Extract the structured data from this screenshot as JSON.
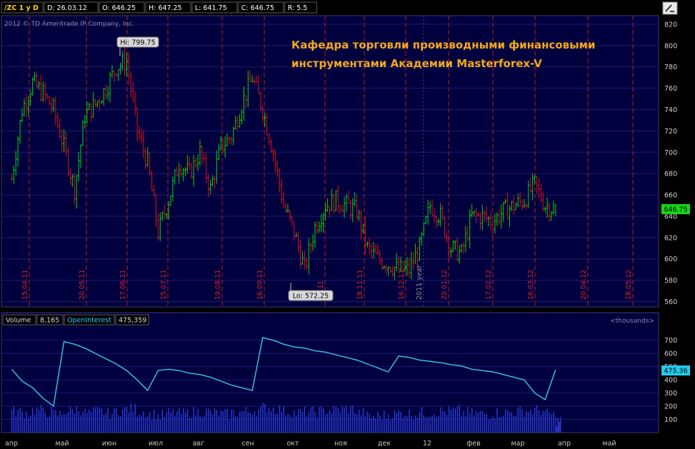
{
  "header": {
    "symbol": "/ZC 1 y D",
    "fields": [
      "D: 26.03.12",
      "O: 646.25",
      "H: 647.25",
      "L: 641.75",
      "C: 646.75",
      "R: 5.5"
    ],
    "copyright": "2012 © TD Ameritrade IP Company, Inc."
  },
  "overlay_title_line1": "Кафедра торговли производными финансовыми",
  "overlay_title_line2": "инструментами Академии Masterforex-V",
  "colors": {
    "background": "#00003e",
    "grid": "#1c1c70",
    "up_bar": "#00d800",
    "down_bar": "#e01010",
    "vline": "#c81818",
    "oi_line": "#33ccee",
    "volume": "#2a3cd8",
    "accent_title": "#f2a81c",
    "last_price_bg": "#16d616",
    "last_oi_bg": "#22ccee"
  },
  "chart_data": [
    {
      "type": "line",
      "title": "",
      "ylim": [
        555,
        828
      ],
      "y_ticks": [
        560,
        580,
        600,
        620,
        640,
        660,
        680,
        700,
        720,
        740,
        760,
        780,
        800,
        820
      ],
      "x_event_labels": [
        "15.04.11",
        "20.05.11",
        "17.06.11",
        "15.07.11",
        "19.08.11",
        "16.09.11",
        "10.11",
        "18.11.11",
        "16.12.11",
        "2011 year",
        "20.01.12",
        "17.02.12",
        "16.03.12",
        "20.04.12",
        "18.05.12"
      ],
      "x_month_labels": [
        "апр",
        "май",
        "июн",
        "июл",
        "авг",
        "сен",
        "окт",
        "ноя",
        "дек",
        "12",
        "фев",
        "мар",
        "апр",
        "май"
      ],
      "annotations": {
        "hi": "Hi: 799.75",
        "lo": "Lo: 572.25"
      },
      "last_price": "646.75",
      "series": [
        {
          "x": [
            "2011-03-28",
            "2011-04-04",
            "2011-04-11",
            "2011-04-18",
            "2011-04-25",
            "2011-05-02",
            "2011-05-09",
            "2011-05-16",
            "2011-05-23",
            "2011-05-30",
            "2011-06-06",
            "2011-06-13",
            "2011-06-20",
            "2011-06-27",
            "2011-07-04",
            "2011-07-11",
            "2011-07-18",
            "2011-07-25",
            "2011-08-01",
            "2011-08-08",
            "2011-08-15",
            "2011-08-22",
            "2011-08-29",
            "2011-09-05",
            "2011-09-12",
            "2011-09-19",
            "2011-09-26",
            "2011-10-03",
            "2011-10-10",
            "2011-10-17",
            "2011-10-24",
            "2011-10-31",
            "2011-11-07",
            "2011-11-14",
            "2011-11-21",
            "2011-11-28",
            "2011-12-05",
            "2011-12-12",
            "2011-12-19",
            "2011-12-26",
            "2012-01-02",
            "2012-01-09",
            "2012-01-16",
            "2012-01-23",
            "2012-01-30",
            "2012-02-06",
            "2012-02-13",
            "2012-02-20",
            "2012-02-27",
            "2012-03-05",
            "2012-03-12",
            "2012-03-19",
            "2012-03-26"
          ],
          "values": [
            675,
            740,
            765,
            755,
            740,
            705,
            665,
            735,
            745,
            760,
            780,
            785,
            720,
            690,
            625,
            655,
            690,
            680,
            700,
            665,
            705,
            715,
            745,
            770,
            740,
            700,
            650,
            625,
            590,
            630,
            650,
            655,
            650,
            645,
            610,
            600,
            595,
            590,
            590,
            610,
            650,
            640,
            610,
            605,
            640,
            640,
            635,
            645,
            650,
            655,
            670,
            650,
            646.75
          ]
        }
      ]
    },
    {
      "type": "line",
      "title": "",
      "header": {
        "volume_label": "Volume",
        "volume_value": "8,165",
        "oi_label": "OpenInterest",
        "oi_value": "475,359",
        "units": "<thousands>"
      },
      "ylim": [
        0,
        790
      ],
      "y_ticks": [
        100,
        200,
        300,
        400,
        500,
        600,
        700
      ],
      "last_value": "475.36",
      "series": [
        {
          "name": "OpenInterest",
          "x": [
            "2011-03-28",
            "2011-04-04",
            "2011-04-11",
            "2011-04-18",
            "2011-04-25",
            "2011-05-02",
            "2011-05-09",
            "2011-05-16",
            "2011-05-23",
            "2011-05-30",
            "2011-06-06",
            "2011-06-13",
            "2011-06-20",
            "2011-06-27",
            "2011-07-04",
            "2011-07-11",
            "2011-07-18",
            "2011-07-25",
            "2011-08-01",
            "2011-08-08",
            "2011-08-15",
            "2011-08-22",
            "2011-08-29",
            "2011-09-05",
            "2011-09-12",
            "2011-09-19",
            "2011-09-26",
            "2011-10-03",
            "2011-10-10",
            "2011-10-17",
            "2011-10-24",
            "2011-10-31",
            "2011-11-07",
            "2011-11-14",
            "2011-11-21",
            "2011-11-28",
            "2011-12-05",
            "2011-12-12",
            "2011-12-19",
            "2011-12-26",
            "2012-01-02",
            "2012-01-09",
            "2012-01-16",
            "2012-01-23",
            "2012-01-30",
            "2012-02-06",
            "2012-02-13",
            "2012-02-20",
            "2012-02-27",
            "2012-03-05",
            "2012-03-12",
            "2012-03-19",
            "2012-03-26"
          ],
          "values": [
            480,
            390,
            340,
            260,
            200,
            690,
            670,
            640,
            600,
            560,
            520,
            470,
            400,
            320,
            470,
            480,
            470,
            450,
            440,
            420,
            390,
            360,
            340,
            320,
            720,
            700,
            670,
            650,
            640,
            620,
            610,
            590,
            570,
            550,
            520,
            490,
            460,
            580,
            570,
            550,
            540,
            530,
            515,
            505,
            480,
            470,
            460,
            440,
            420,
            400,
            300,
            250,
            475.36
          ]
        },
        {
          "name": "Volume",
          "values": [
            160,
            150,
            170,
            155,
            140,
            165,
            175,
            150,
            160,
            145,
            170,
            180,
            160,
            140,
            130,
            150,
            145,
            155,
            160,
            150,
            140,
            150,
            160,
            170,
            190,
            180,
            160,
            150,
            155,
            160,
            170,
            175,
            180,
            150,
            120,
            130,
            140,
            150,
            145,
            150,
            155,
            160,
            165,
            150,
            145,
            140,
            150,
            155,
            160,
            165,
            170,
            140,
            90
          ]
        }
      ]
    }
  ]
}
